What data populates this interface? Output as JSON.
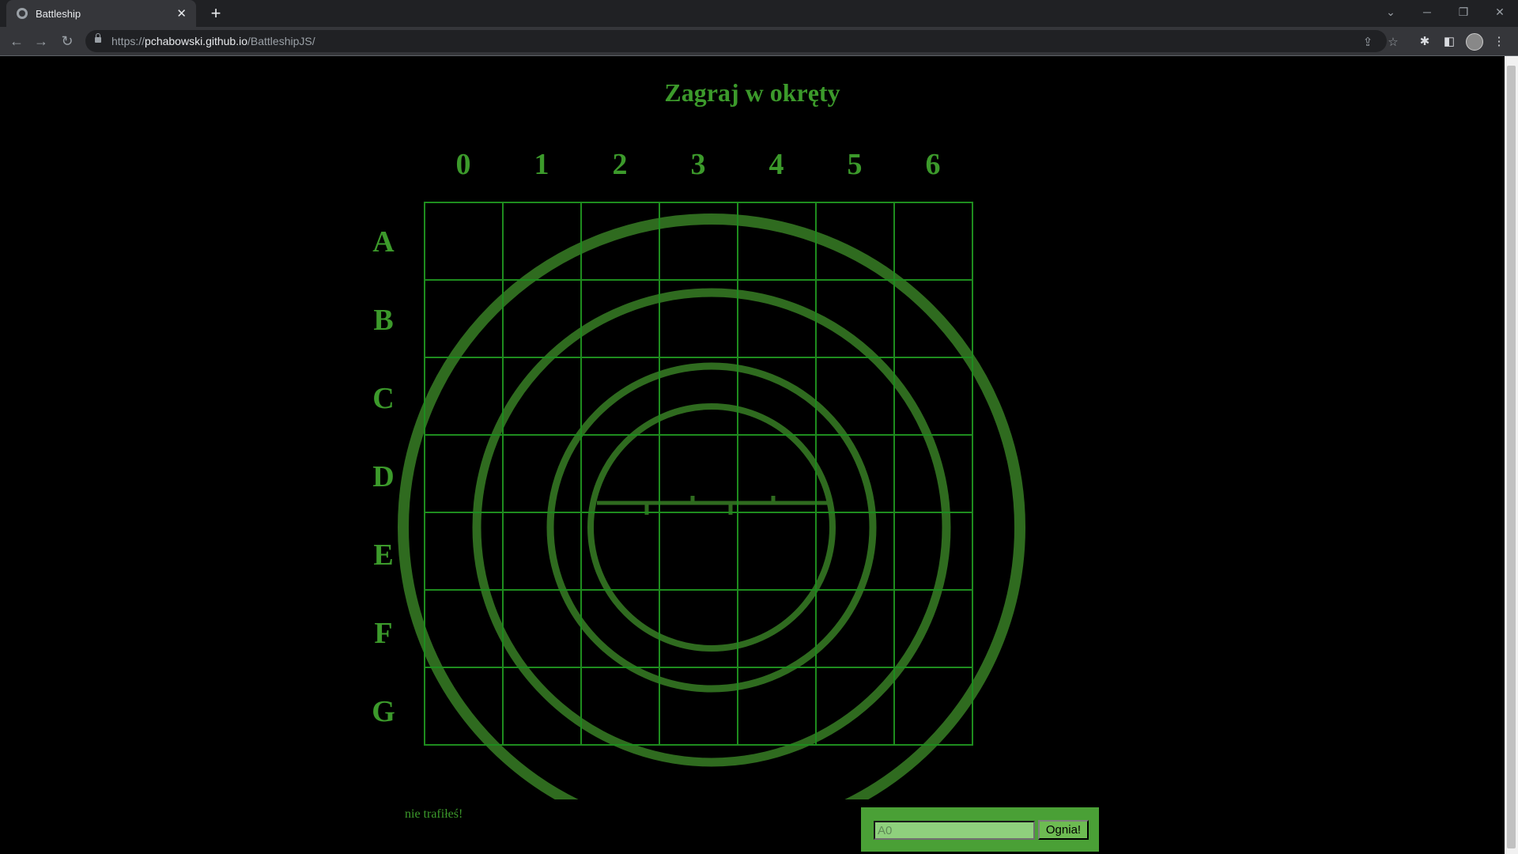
{
  "browser": {
    "tab_title": "Battleship",
    "url_scheme": "https://",
    "url_host": "pchabowski.github.io",
    "url_path": "/BattleshipJS/"
  },
  "game": {
    "title": "Zagraj w okręty",
    "columns": [
      "0",
      "1",
      "2",
      "3",
      "4",
      "5",
      "6"
    ],
    "rows": [
      "A",
      "B",
      "C",
      "D",
      "E",
      "F",
      "G"
    ],
    "message": "nie trafiłeś!",
    "guess_placeholder": "A0",
    "fire_label": "Ognia!"
  },
  "colors": {
    "background": "#000000",
    "text_green": "#3c9a2b",
    "grid_green": "#1e8c1e",
    "radar_green": "#2f6b1f",
    "form_green": "#4aa036"
  }
}
